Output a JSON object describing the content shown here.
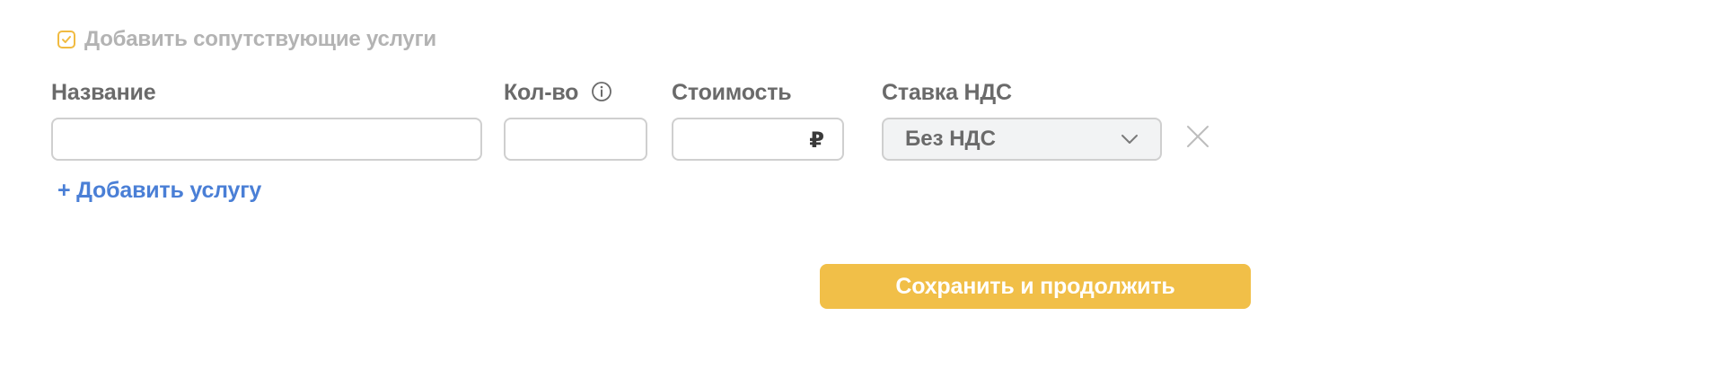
{
  "services_option": {
    "checked": true,
    "label": "Добавить сопутствующие услуги"
  },
  "labels": {
    "name": "Название",
    "quantity": "Кол-во",
    "price": "Стоимость",
    "vat_rate": "Ставка НДС"
  },
  "fields": {
    "name_value": "",
    "quantity_value": "",
    "price_value": "",
    "currency_symbol": "₽",
    "vat_selected": "Без НДС"
  },
  "actions": {
    "add_service": "+ Добавить услугу",
    "save_continue": "Сохранить и продолжить"
  },
  "icons": {
    "checkbox": "check-icon",
    "quantity_info": "info-icon",
    "select_arrow": "chevron-down-icon",
    "remove_row": "close-icon"
  },
  "colors": {
    "accent": "#f1bf48",
    "checkbox_border": "#f1bb41",
    "link": "#4a7fd6",
    "muted_text": "#b3b3b3"
  }
}
